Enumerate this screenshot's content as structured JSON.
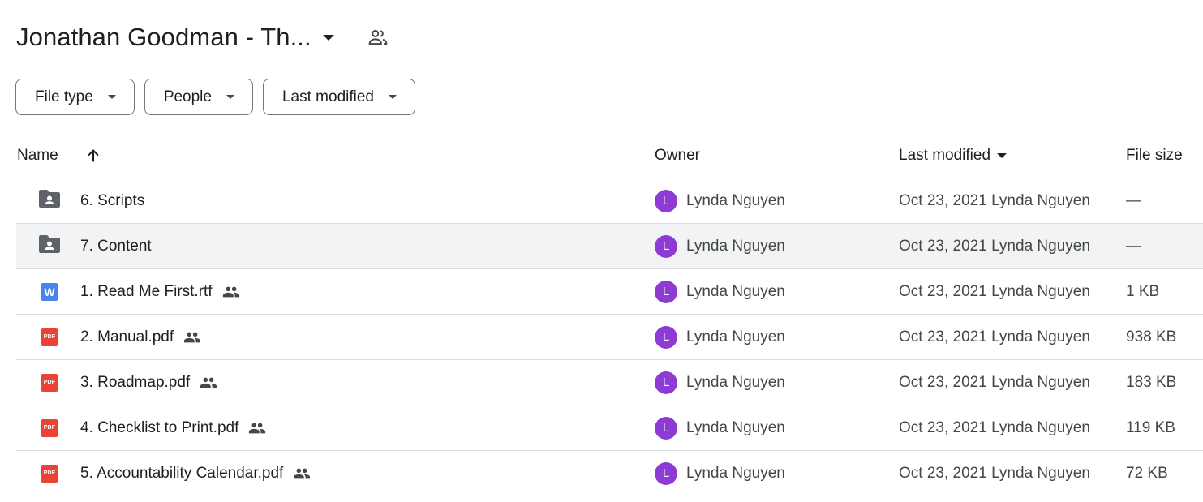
{
  "folder": {
    "title": "Jonathan Goodman - Th...",
    "share_icon": "people-outline-icon"
  },
  "filters": [
    {
      "label": "File type"
    },
    {
      "label": "People"
    },
    {
      "label": "Last modified"
    }
  ],
  "columns": {
    "name": "Name",
    "owner": "Owner",
    "last_modified": "Last modified",
    "file_size": "File size"
  },
  "colors": {
    "avatar": "#8e3bd4",
    "word": "#4a82e8",
    "pdf": "#ea4335",
    "folder": "#5f6368",
    "selected_row": "#f1f3f4"
  },
  "files": [
    {
      "type": "shared-folder",
      "name": "6. Scripts",
      "shared": false,
      "owner_initial": "L",
      "owner": "Lynda Nguyen",
      "modified": "Oct 23, 2021 Lynda Nguyen",
      "size": "—",
      "selected": false
    },
    {
      "type": "shared-folder",
      "name": "7. Content",
      "shared": false,
      "owner_initial": "L",
      "owner": "Lynda Nguyen",
      "modified": "Oct 23, 2021 Lynda Nguyen",
      "size": "—",
      "selected": true
    },
    {
      "type": "word",
      "icon_text": "W",
      "name": "1. Read Me First.rtf",
      "shared": true,
      "owner_initial": "L",
      "owner": "Lynda Nguyen",
      "modified": "Oct 23, 2021 Lynda Nguyen",
      "size": "1 KB",
      "selected": false
    },
    {
      "type": "pdf",
      "icon_text": "PDF",
      "name": "2. Manual.pdf",
      "shared": true,
      "owner_initial": "L",
      "owner": "Lynda Nguyen",
      "modified": "Oct 23, 2021 Lynda Nguyen",
      "size": "938 KB",
      "selected": false
    },
    {
      "type": "pdf",
      "icon_text": "PDF",
      "name": "3. Roadmap.pdf",
      "shared": true,
      "owner_initial": "L",
      "owner": "Lynda Nguyen",
      "modified": "Oct 23, 2021 Lynda Nguyen",
      "size": "183 KB",
      "selected": false
    },
    {
      "type": "pdf",
      "icon_text": "PDF",
      "name": "4. Checklist to Print.pdf",
      "shared": true,
      "owner_initial": "L",
      "owner": "Lynda Nguyen",
      "modified": "Oct 23, 2021 Lynda Nguyen",
      "size": "119 KB",
      "selected": false
    },
    {
      "type": "pdf",
      "icon_text": "PDF",
      "name": "5. Accountability Calendar.pdf",
      "shared": true,
      "owner_initial": "L",
      "owner": "Lynda Nguyen",
      "modified": "Oct 23, 2021 Lynda Nguyen",
      "size": "72 KB",
      "selected": false
    }
  ]
}
